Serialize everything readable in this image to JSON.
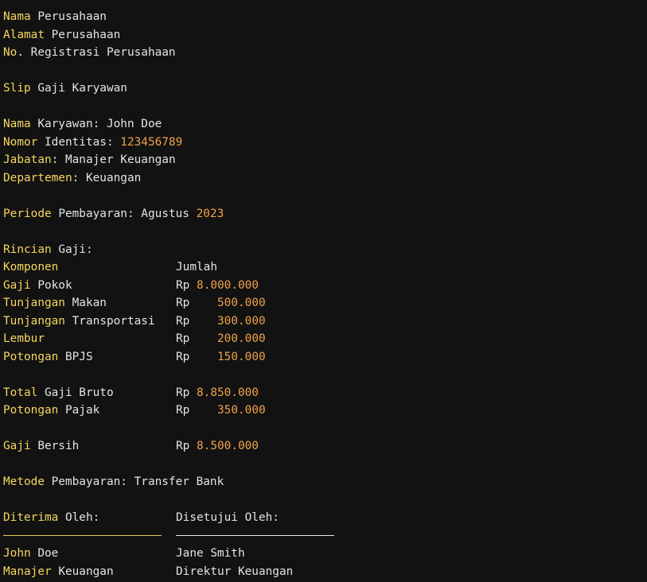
{
  "colors": {
    "background": "#121212",
    "keyword": "#f6d65e",
    "number": "#f0a24a",
    "text": "#e4e4e4"
  },
  "header": {
    "name": {
      "k": "Nama",
      "t": " Perusahaan"
    },
    "address": {
      "k": "Alamat",
      "t": " Perusahaan"
    },
    "registration": {
      "k": "No",
      "t": ". Registrasi Perusahaan"
    }
  },
  "slip_title": {
    "k": "Slip",
    "t": " Gaji Karyawan"
  },
  "employee": {
    "name": {
      "k": "Nama",
      "t": " Karyawan: John Doe"
    },
    "id": {
      "k": "Nomor",
      "t": " Identitas: ",
      "n": "123456789"
    },
    "position": {
      "k": "Jabatan",
      "t": ": Manajer Keuangan"
    },
    "department": {
      "k": "Departemen",
      "t": ": Keuangan"
    }
  },
  "period": {
    "k": "Periode",
    "t": " Pembayaran: Agustus ",
    "n": "2023"
  },
  "salary": {
    "heading": {
      "k": "Rincian",
      "t": " Gaji:"
    },
    "col_header": {
      "k": "Komponen",
      "amount_label": "Jumlah"
    },
    "currency": "Rp",
    "rows": [
      {
        "k": "Gaji",
        "t": " Pokok",
        "amount": "8.000.000"
      },
      {
        "k": "Tunjangan",
        "t": " Makan",
        "amount": "500.000"
      },
      {
        "k": "Tunjangan",
        "t": " Transportasi",
        "amount": "300.000"
      },
      {
        "k": "Lembur",
        "t": "",
        "amount": "200.000"
      },
      {
        "k": "Potongan",
        "t": " BPJS",
        "amount": "150.000"
      }
    ],
    "gross": {
      "k": "Total",
      "t": " Gaji Bruto",
      "amount": "8.850.000"
    },
    "tax": {
      "k": "Potongan",
      "t": " Pajak",
      "amount": "350.000"
    },
    "net": {
      "k": "Gaji",
      "t": " Bersih",
      "amount": "8.500.000"
    }
  },
  "payment": {
    "k": "Metode",
    "t": " Pembayaran: Transfer Bank"
  },
  "signatures": {
    "received": {
      "k": "Diterima",
      "t": " Oleh:"
    },
    "approved": "Disetujui Oleh:",
    "receiver_name": {
      "k": "John",
      "t": " Doe"
    },
    "receiver_title": {
      "k": "Manajer",
      "t": " Keuangan"
    },
    "approver_name": "Jane Smith",
    "approver_title": "Direktur Keuangan"
  }
}
